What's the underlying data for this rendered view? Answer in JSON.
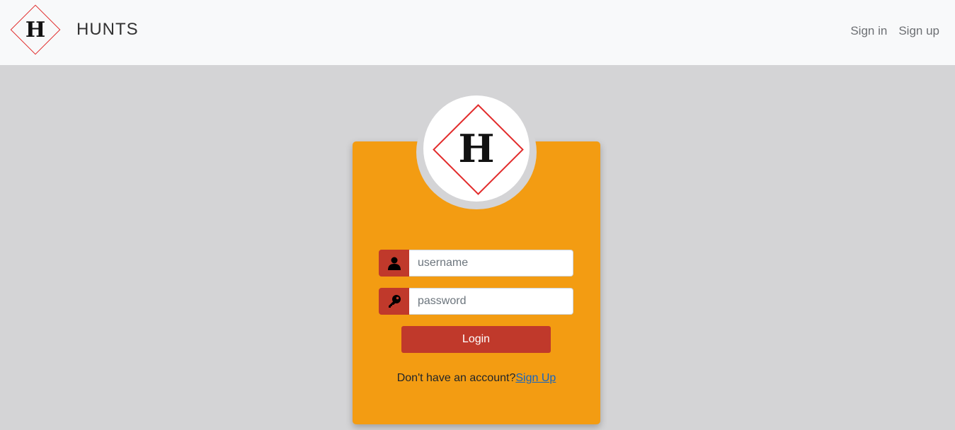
{
  "brand": {
    "logo_letter": "H",
    "name": "HUNTS"
  },
  "nav": {
    "sign_in": "Sign in",
    "sign_up": "Sign up"
  },
  "login_card": {
    "logo_letter": "H",
    "username_placeholder": "username",
    "password_placeholder": "password",
    "login_label": "Login",
    "no_account_text": "Don't have an account?",
    "signup_link": "Sign Up"
  },
  "icons": {
    "username": "user-icon",
    "password": "key-icon"
  },
  "colors": {
    "card": "#f39c12",
    "accent": "#c0392b",
    "logo_red": "#e22c2c",
    "page_bg": "#d4d4d6",
    "navbar_bg": "#f8f9fa"
  }
}
